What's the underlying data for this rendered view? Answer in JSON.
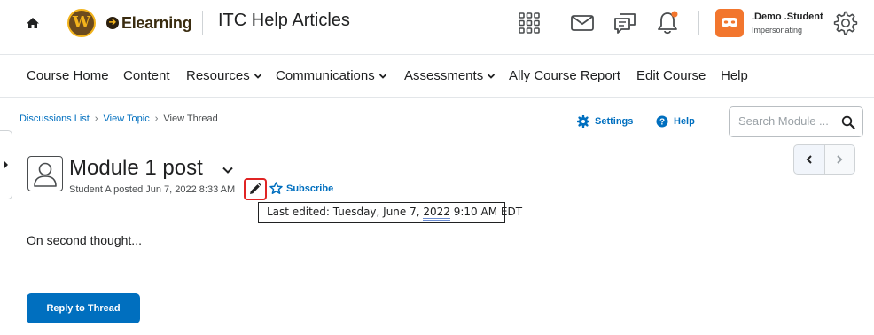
{
  "header": {
    "logo_letter": "W",
    "brand_name": "Elearning",
    "org_title": "ITC Help Articles",
    "user_name": ".Demo .Student",
    "user_role": "Impersonating",
    "icons": [
      "home-icon",
      "grid-icon",
      "mail-icon",
      "chat-icon",
      "bell-icon",
      "gear-icon"
    ],
    "colors": {
      "brand_brown": "#6b4a1d",
      "brand_gold": "#f2b31b",
      "avatar_orange": "#f2762e",
      "notify_dot": "#f2762e"
    }
  },
  "nav": {
    "items": [
      {
        "label": "Course Home",
        "dropdown": false
      },
      {
        "label": "Content",
        "dropdown": false
      },
      {
        "label": "Resources",
        "dropdown": true
      },
      {
        "label": "Communications",
        "dropdown": true
      },
      {
        "label": "Assessments",
        "dropdown": true
      },
      {
        "label": "Ally Course Report",
        "dropdown": false
      },
      {
        "label": "Edit Course",
        "dropdown": false
      },
      {
        "label": "Help",
        "dropdown": false
      }
    ]
  },
  "breadcrumb": {
    "items": [
      "Discussions List",
      "View Topic",
      "View Thread"
    ]
  },
  "toolbar": {
    "settings_label": "Settings",
    "help_label": "Help",
    "search_placeholder": "Search Module ..."
  },
  "post": {
    "title": "Module 1 post",
    "meta": "Student A posted Jun 7, 2022 8:33 AM",
    "subscribe_label": "Subscribe",
    "tooltip_prefix": "Last edited: Tuesday, June 7, ",
    "tooltip_year": "2022",
    "tooltip_suffix": " 9:10 AM EDT",
    "body": "On second thought..."
  },
  "actions": {
    "reply_label": "Reply to Thread"
  },
  "colors": {
    "link": "#006fbf",
    "primary_button": "#006fbf",
    "highlight_box": "#e02424"
  }
}
